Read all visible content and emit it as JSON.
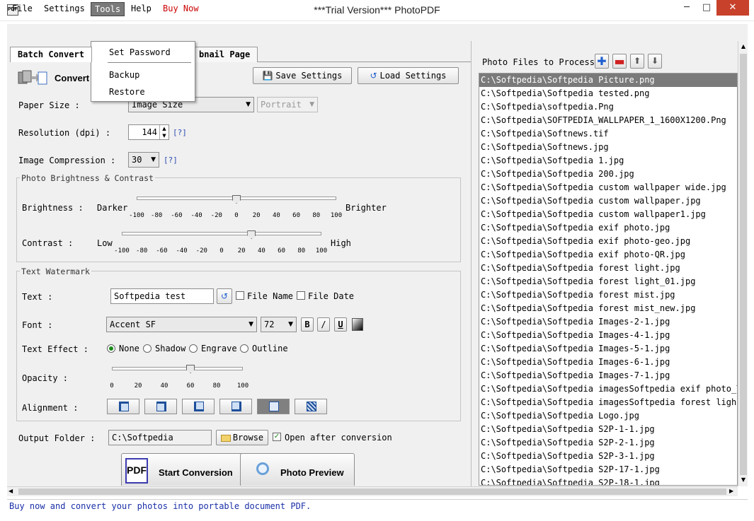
{
  "window": {
    "title": "***Trial Version*** PhotoPDF",
    "icon_text": "PDF",
    "min_glyph": "─",
    "max_glyph": "□",
    "close_glyph": "✕"
  },
  "menu": {
    "file": "File",
    "settings": "Settings",
    "tools": "Tools",
    "help": "Help",
    "buy_now": "Buy Now",
    "buy_now_color": "#cc0000"
  },
  "tools_menu": {
    "set_password": "Set Password",
    "backup": "Backup",
    "restore": "Restore"
  },
  "tabs": {
    "batch_convert": "Batch Convert",
    "thumbnail_page": "bnail Page"
  },
  "convert": {
    "heading": "Convert P",
    "save_settings": "Save Settings",
    "load_settings": "Load Settings"
  },
  "paper": {
    "label": "Paper Size :",
    "size_value": "Image Size",
    "orientation_value": "Portrait"
  },
  "resolution": {
    "label": "Resolution (dpi) :",
    "value": "144",
    "help": "[?]"
  },
  "compression": {
    "label": "Image Compression :",
    "value": "30",
    "help": "[?]"
  },
  "brightness_group": {
    "legend": "Photo Brightness & Contrast",
    "brightness_label": "Brightness :",
    "darker": "Darker",
    "brighter": "Brighter",
    "brightness_value": 0,
    "contrast_label": "Contrast :",
    "low": "Low",
    "high": "High",
    "contrast_value": 30,
    "ticks": [
      "-100",
      "-80",
      "-60",
      "-40",
      "-20",
      "0",
      "20",
      "40",
      "60",
      "80",
      "100"
    ]
  },
  "watermark": {
    "legend": "Text Watermark",
    "text_label": "Text :",
    "text_value": "Softpedia test",
    "file_name": "File Name",
    "file_date": "File Date",
    "font_label": "Font :",
    "font_value": "Accent SF",
    "size_value": "72",
    "bold": "B",
    "italic": "/",
    "underline": "U",
    "effect_label": "Text Effect :",
    "effects": [
      "None",
      "Shadow",
      "Engrave",
      "Outline"
    ],
    "selected_effect": "None",
    "opacity_label": "Opacity :",
    "opacity_value": 60,
    "opacity_ticks": [
      "0",
      "20",
      "40",
      "60",
      "80",
      "100"
    ],
    "alignment_label": "Alignment :"
  },
  "output": {
    "label": "Output Folder :",
    "value": "C:\\Softpedia",
    "browse": "Browse",
    "open_after": "Open after conversion"
  },
  "actions": {
    "start": "Start Conversion",
    "preview": "Photo Preview",
    "pdf_badge": "PDF"
  },
  "files": {
    "heading": "Photo Files to Process",
    "items": [
      "C:\\Softpedia\\Softpedia Picture.png",
      "C:\\Softpedia\\Softpedia tested.png",
      "C:\\Softpedia\\softpedia.Png",
      "C:\\Softpedia\\SOFTPEDIA_WALLPAPER_1_1600X1200.Png",
      "C:\\Softpedia\\Softnews.tif",
      "C:\\Softpedia\\Softnews.jpg",
      "C:\\Softpedia\\Softpedia 1.jpg",
      "C:\\Softpedia\\Softpedia 200.jpg",
      "C:\\Softpedia\\Softpedia custom wallpaper wide.jpg",
      "C:\\Softpedia\\Softpedia custom wallpaper.jpg",
      "C:\\Softpedia\\Softpedia custom wallpaper1.jpg",
      "C:\\Softpedia\\Softpedia exif photo.jpg",
      "C:\\Softpedia\\Softpedia exif photo-geo.jpg",
      "C:\\Softpedia\\Softpedia exif photo-QR.jpg",
      "C:\\Softpedia\\Softpedia forest light.jpg",
      "C:\\Softpedia\\Softpedia forest light_01.jpg",
      "C:\\Softpedia\\Softpedia forest mist.jpg",
      "C:\\Softpedia\\Softpedia forest mist_new.jpg",
      "C:\\Softpedia\\Softpedia Images-2-1.jpg",
      "C:\\Softpedia\\Softpedia Images-4-1.jpg",
      "C:\\Softpedia\\Softpedia Images-5-1.jpg",
      "C:\\Softpedia\\Softpedia Images-6-1.jpg",
      "C:\\Softpedia\\Softpedia Images-7-1.jpg",
      "C:\\Softpedia\\Softpedia imagesSoftpedia exif photo_Ta",
      "C:\\Softpedia\\Softpedia imagesSoftpedia forest light_",
      "C:\\Softpedia\\Softpedia Logo.jpg",
      "C:\\Softpedia\\Softpedia S2P-1-1.jpg",
      "C:\\Softpedia\\Softpedia S2P-2-1.jpg",
      "C:\\Softpedia\\Softpedia S2P-3-1.jpg",
      "C:\\Softpedia\\Softpedia S2P-17-1.jpg",
      "C:\\Softpedia\\Softpedia S2P-18-1.jpg"
    ],
    "selected_index": 0
  },
  "status": {
    "text": "Buy now and convert your photos into portable document PDF.",
    "color": "#1a2fa8"
  },
  "colors": {
    "accent_blue": "#1e5fd0",
    "remove_red": "#d02020"
  }
}
